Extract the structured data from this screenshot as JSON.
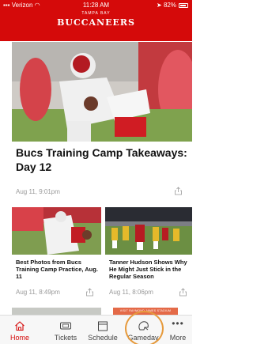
{
  "status_bar": {
    "carrier": "Verizon",
    "time": "11:28 AM",
    "battery": "82%"
  },
  "header": {
    "team_small": "TAMPA BAY",
    "team_name": "BUCCANEERS"
  },
  "hero": {
    "title": "Bucs Training Camp Takeaways: Day 12",
    "date": "Aug 11, 9:01pm"
  },
  "cards": [
    {
      "title": "Best Photos from Bucs Training Camp Practice, Aug. 11",
      "date": "Aug 11, 8:49pm"
    },
    {
      "title": "Tanner Hudson Shows Why He Might Just Stick in the Regular Season",
      "date": "Aug 11, 8:06pm"
    }
  ],
  "gameday_hint": "VISIT RAYMOND JAMES STADIUM",
  "tabs": [
    {
      "label": "Home",
      "icon": "home-icon",
      "active": true
    },
    {
      "label": "Tickets",
      "icon": "ticket-icon"
    },
    {
      "label": "Schedule",
      "icon": "calendar-icon"
    },
    {
      "label": "Gameday",
      "icon": "helmet-icon"
    },
    {
      "label": "More",
      "icon": "more-icon"
    }
  ],
  "colors": {
    "brand": "#d50a0a",
    "highlight": "#e69a3c"
  }
}
